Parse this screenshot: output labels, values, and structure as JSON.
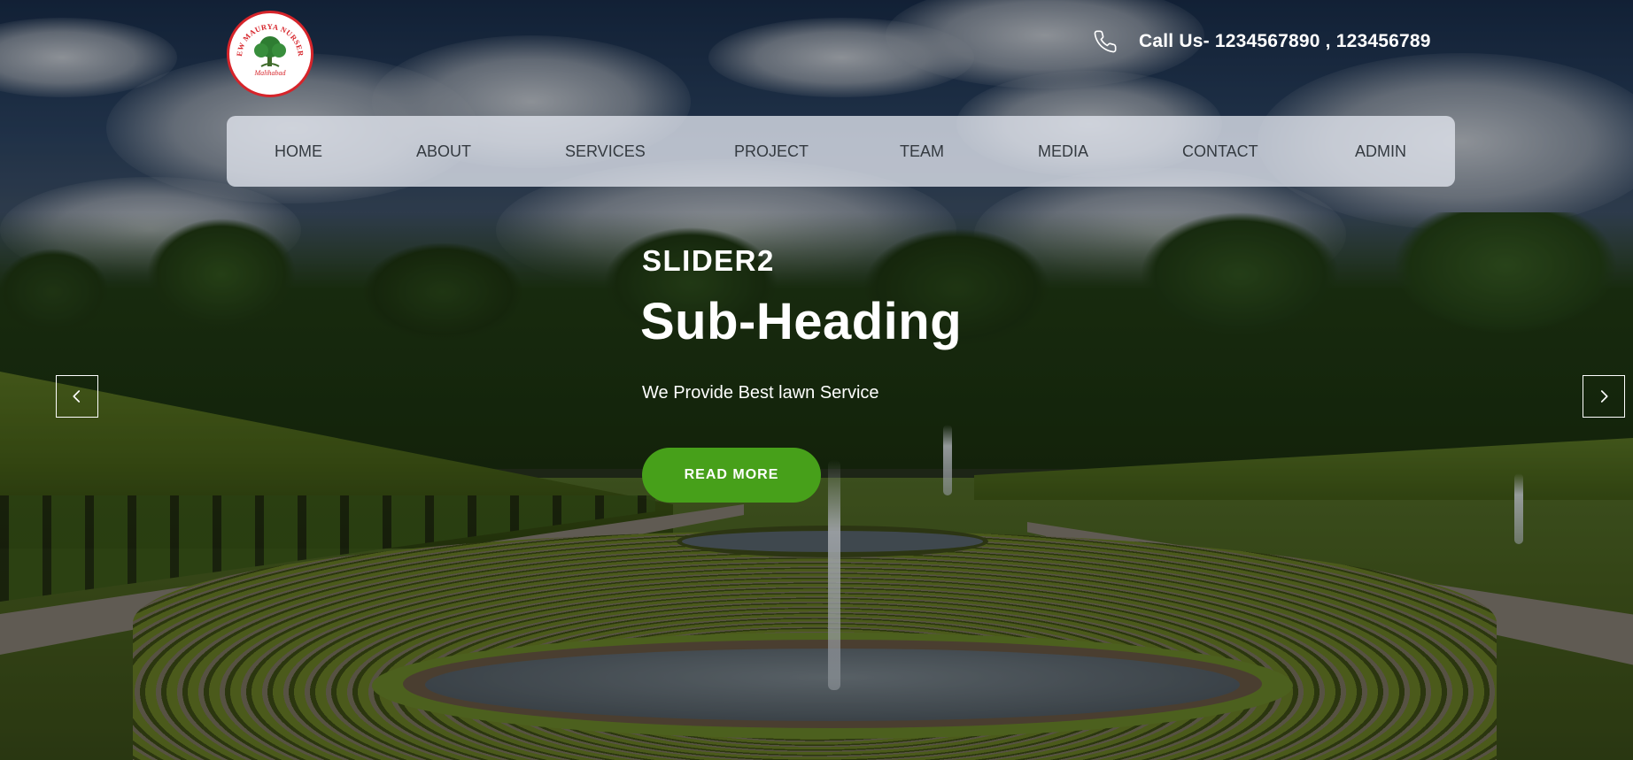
{
  "header": {
    "logo": {
      "brand_text": "NEW MAURYA NURSERY",
      "location_text": "Malihabad",
      "icon": "tree-logo-icon"
    },
    "call": {
      "icon": "phone-icon",
      "text": "Call Us- 1234567890 , 123456789"
    }
  },
  "nav": {
    "items": [
      {
        "label": "HOME"
      },
      {
        "label": "ABOUT"
      },
      {
        "label": "SERVICES"
      },
      {
        "label": "PROJECT"
      },
      {
        "label": "TEAM"
      },
      {
        "label": "MEDIA"
      },
      {
        "label": "CONTACT"
      },
      {
        "label": "ADMIN"
      }
    ]
  },
  "slider": {
    "label": "SLIDER2",
    "heading": "Sub-Heading",
    "description": "We Provide Best lawn Service",
    "cta_label": "READ MORE",
    "prev_icon": "chevron-left-icon",
    "next_icon": "chevron-right-icon"
  },
  "colors": {
    "accent_green": "#47a01a",
    "nav_text": "#343a40",
    "logo_red": "#d6242a",
    "logo_green": "#2e7d32"
  }
}
